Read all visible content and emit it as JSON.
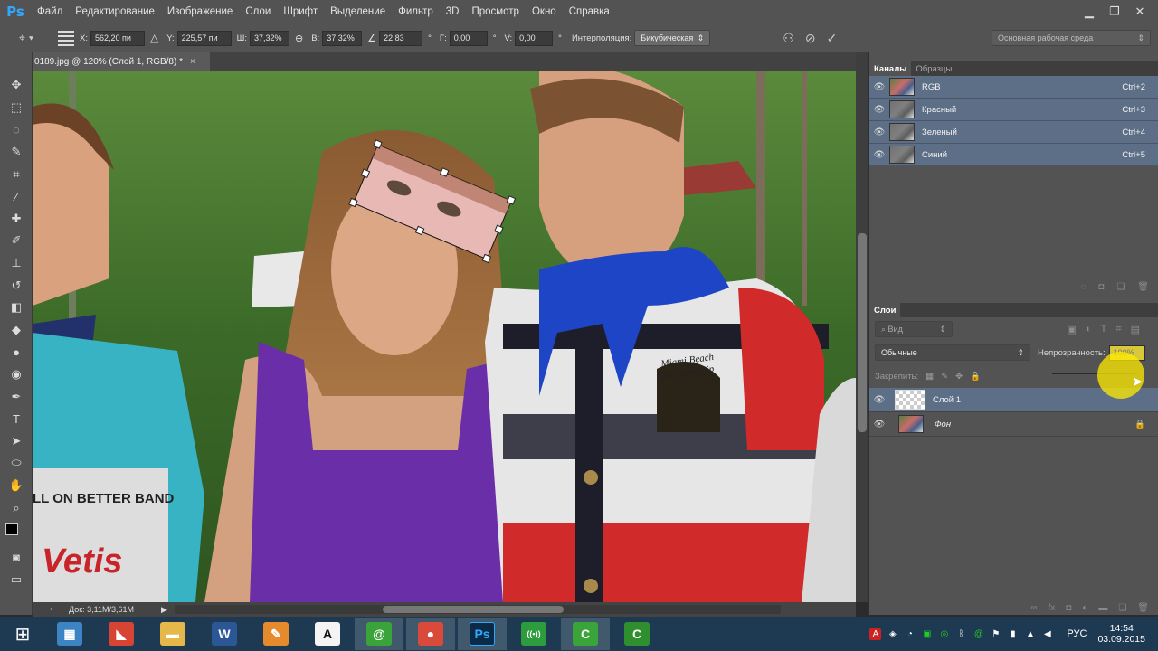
{
  "app": {
    "logo": "Ps"
  },
  "menu": [
    "Файл",
    "Редактирование",
    "Изображение",
    "Слои",
    "Шрифт",
    "Выделение",
    "Фильтр",
    "3D",
    "Просмотр",
    "Окно",
    "Справка"
  ],
  "window_controls": {
    "minimize": "▁",
    "restore": "❐",
    "close": "✕"
  },
  "options": {
    "x_label": "X:",
    "x_value": "562,20 пи",
    "y_label": "Y:",
    "y_value": "225,57 пи",
    "w_label": "Ш:",
    "w_value": "37,32%",
    "h_label": "В:",
    "h_value": "37,32%",
    "angle_value": "22,83",
    "angle_unit": "°",
    "hskew_label": "Г:",
    "hskew_value": "0,00",
    "vskew_label": "V:",
    "vskew_value": "0,00",
    "interp_label": "Интерполяция:",
    "interp_value": "Бикубическая",
    "workspace": "Основная рабочая среда"
  },
  "document": {
    "tab_title": "0189.jpg @ 120% (Слой 1, RGB/8) *",
    "tab_close": "×",
    "status": "Док: 3,11M/3,61M"
  },
  "channels_panel": {
    "tabs": [
      "Каналы",
      "Образцы"
    ],
    "rows": [
      {
        "name": "RGB",
        "shortcut": "Ctrl+2"
      },
      {
        "name": "Красный",
        "shortcut": "Ctrl+3"
      },
      {
        "name": "Зеленый",
        "shortcut": "Ctrl+4"
      },
      {
        "name": "Синий",
        "shortcut": "Ctrl+5"
      }
    ]
  },
  "layers_panel": {
    "tab": "Слои",
    "filter_kind": "Вид",
    "blend_mode": "Обычные",
    "opacity_label": "Непрозрачность:",
    "opacity_value": "100%",
    "lock_label": "Закрепить:",
    "layers": [
      {
        "name": "Слой 1",
        "selected": true
      },
      {
        "name": "Фон",
        "selected": false,
        "locked": true
      }
    ]
  },
  "canvas_text": {
    "shirt_boy_right_1": "Miami Beach",
    "shirt_boy_right_2": "Championship",
    "shirt_left_1": "LL ON BETTER BAND",
    "shirt_left_2": "Vetis"
  },
  "taskbar": {
    "lang": "РУС",
    "time": "14:54",
    "date": "03.09.2015",
    "apps": [
      {
        "name": "calculator",
        "glyph": "▦",
        "color": "#3c84c4"
      },
      {
        "name": "slides",
        "glyph": "◣",
        "color": "#d84434"
      },
      {
        "name": "explorer",
        "glyph": "▬",
        "color": "#e6b84a"
      },
      {
        "name": "word",
        "glyph": "W",
        "color": "#2b5797"
      },
      {
        "name": "paint",
        "glyph": "✎",
        "color": "#e68a2e"
      },
      {
        "name": "font",
        "glyph": "A",
        "color": "#f4f4f4"
      },
      {
        "name": "mail",
        "glyph": "@",
        "color": "#3aa43a"
      },
      {
        "name": "chrome",
        "glyph": "●",
        "color": "#d94a3a"
      },
      {
        "name": "photoshop",
        "glyph": "Ps",
        "color": "#0b2a45"
      },
      {
        "name": "network",
        "glyph": "((•))",
        "color": "#2c9c3c"
      },
      {
        "name": "camtasia",
        "glyph": "C",
        "color": "#3aa43a"
      },
      {
        "name": "camtasia-recorder",
        "glyph": "C",
        "color": "#2f8f2f"
      }
    ]
  }
}
